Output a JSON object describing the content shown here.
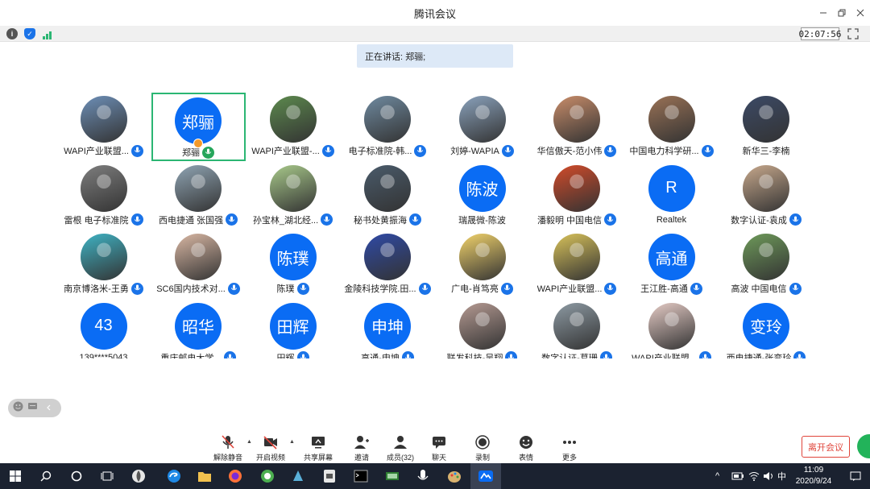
{
  "window": {
    "title": "腾讯会议",
    "minimize_icon": "minimize-icon",
    "restore_icon": "restore-icon",
    "close_icon": "close-icon"
  },
  "infobar": {
    "timer": "02:07:56",
    "icons": [
      "info-icon",
      "shield-icon",
      "signal-icon",
      "fullscreen-icon"
    ]
  },
  "speaking": {
    "text": "正在讲话: 郑骊;"
  },
  "participants": [
    {
      "name": "WAPI产业联盟...",
      "avatar": "photo",
      "photo_color": "#6d8fb7",
      "mic": "blue"
    },
    {
      "name": "郑骊",
      "avatar": "text",
      "avatar_text": "郑骊",
      "mic": "green",
      "active": true,
      "host": true
    },
    {
      "name": "WAPI产业联盟-...",
      "avatar": "photo",
      "photo_color": "#5d8a4e",
      "mic": "blue"
    },
    {
      "name": "电子标准院-韩...",
      "avatar": "photo",
      "photo_color": "#6f8aa0",
      "mic": "blue"
    },
    {
      "name": "刘婷-WAPIA",
      "avatar": "photo",
      "photo_color": "#8aa2bc",
      "mic": "blue"
    },
    {
      "name": "华信傲天-范小伟",
      "avatar": "photo",
      "photo_color": "#c98d6a",
      "mic": "blue"
    },
    {
      "name": "中国电力科学研...",
      "avatar": "photo",
      "photo_color": "#9a7256",
      "mic": "blue"
    },
    {
      "name": "新华三-李楠",
      "avatar": "photo",
      "photo_color": "#3c4a66",
      "mic": "none"
    },
    {
      "name": "雷根 电子标准院",
      "avatar": "photo",
      "photo_color": "#7e7e7e",
      "mic": "blue"
    },
    {
      "name": "西电捷通 张国强",
      "avatar": "photo",
      "photo_color": "#8fa4b3",
      "mic": "blue"
    },
    {
      "name": "孙宝林_湖北经...",
      "avatar": "photo",
      "photo_color": "#a8c98a",
      "mic": "blue"
    },
    {
      "name": "秘书处黄振海",
      "avatar": "photo",
      "photo_color": "#4a5b6b",
      "mic": "blue"
    },
    {
      "name": "瑞晟微-陈波",
      "avatar": "text",
      "avatar_text": "陈波",
      "mic": "none"
    },
    {
      "name": "潘毅明 中国电信",
      "avatar": "photo",
      "photo_color": "#d24b2a",
      "mic": "blue"
    },
    {
      "name": "Realtek",
      "avatar": "text",
      "avatar_text": "R",
      "mic": "none"
    },
    {
      "name": "数字认证-袁成",
      "avatar": "photo",
      "photo_color": "#c7a88c",
      "mic": "blue"
    },
    {
      "name": "南京博洛米-王勇",
      "avatar": "photo",
      "photo_color": "#3fb3c4",
      "mic": "blue"
    },
    {
      "name": "SC6国内技术对...",
      "avatar": "photo",
      "photo_color": "#d9b7a3",
      "mic": "blue"
    },
    {
      "name": "陈璞",
      "avatar": "text",
      "avatar_text": "陈璞",
      "mic": "blue"
    },
    {
      "name": "金陵科技学院.田...",
      "avatar": "photo",
      "photo_color": "#2f4aa6",
      "mic": "blue"
    },
    {
      "name": "广电-肖笃亮",
      "avatar": "photo",
      "photo_color": "#f2d36b",
      "mic": "blue"
    },
    {
      "name": "WAPI产业联盟...",
      "avatar": "photo",
      "photo_color": "#d8c25a",
      "mic": "blue"
    },
    {
      "name": "王江胜-高通",
      "avatar": "text",
      "avatar_text": "高通",
      "mic": "blue"
    },
    {
      "name": "高波 中国电信",
      "avatar": "photo",
      "photo_color": "#6e9a5a",
      "mic": "blue"
    },
    {
      "name": "139****5043",
      "avatar": "text",
      "avatar_text": "43",
      "mic": "none"
    },
    {
      "name": "重庆邮电大学...",
      "avatar": "text",
      "avatar_text": "昭华",
      "mic": "blue"
    },
    {
      "name": "田辉",
      "avatar": "text",
      "avatar_text": "田辉",
      "mic": "blue"
    },
    {
      "name": "高通-申坤",
      "avatar": "text",
      "avatar_text": "申坤",
      "mic": "blue"
    },
    {
      "name": "联发科技-吴翔",
      "avatar": "photo",
      "photo_color": "#b59a92",
      "mic": "blue"
    },
    {
      "name": "数字认证-葛珊",
      "avatar": "photo",
      "photo_color": "#8d9aa3",
      "mic": "blue"
    },
    {
      "name": "WAPI产业联盟...",
      "avatar": "photo",
      "photo_color": "#e5cbc5",
      "mic": "blue"
    },
    {
      "name": "西电捷通-张变玲",
      "avatar": "text",
      "avatar_text": "变玲",
      "mic": "blue"
    }
  ],
  "toolbar": {
    "mute": "解除静音",
    "video": "开启视频",
    "share": "共享屏幕",
    "invite": "邀请",
    "members": "成员(32)",
    "chat": "聊天",
    "record": "录制",
    "emoji": "表情",
    "more": "更多",
    "leave": "离开会议"
  },
  "colors": {
    "accent": "#0a6cf4",
    "active_border": "#2bb673",
    "leave": "#e0453b",
    "taskbar": "#1b2230"
  },
  "taskbar": {
    "apps": [
      "windows-icon",
      "search-icon",
      "cortana-icon",
      "taskview-icon",
      "app-icon",
      "edge-icon",
      "folder-icon",
      "firefox-icon",
      "app-green-icon",
      "app-blue-icon",
      "app-pdf-icon",
      "cmd-icon",
      "app-board-icon",
      "mic-app-icon",
      "paint-icon",
      "tencent-meeting-icon"
    ],
    "tray_lang": "中",
    "time": "11:09",
    "date": "2020/9/24"
  }
}
